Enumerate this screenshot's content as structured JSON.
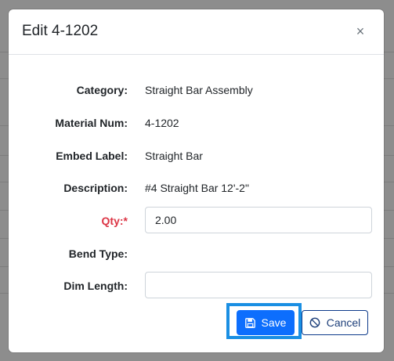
{
  "dialog": {
    "title": "Edit 4-1202",
    "close_glyph": "×"
  },
  "fields": {
    "category": {
      "label": "Category:",
      "value": "Straight Bar Assembly"
    },
    "material_num": {
      "label": "Material Num:",
      "value": "4-1202"
    },
    "embed_label": {
      "label": "Embed Label:",
      "value": "Straight Bar"
    },
    "description": {
      "label": "Description:",
      "value": "#4 Straight Bar 12'-2\""
    },
    "qty": {
      "label": "Qty:",
      "required_mark": "*",
      "value": "2.00"
    },
    "bend_type": {
      "label": "Bend Type:",
      "value": ""
    },
    "dim_length": {
      "label": "Dim Length:",
      "value": ""
    }
  },
  "buttons": {
    "save_label": "Save",
    "save_icon": "floppy-disk-icon",
    "cancel_label": "Cancel",
    "cancel_icon": "ban-icon"
  },
  "colors": {
    "primary": "#0d6efd",
    "required": "#dc3545",
    "highlight": "#1a8fe3",
    "cancel_border": "#0d3a8a"
  }
}
